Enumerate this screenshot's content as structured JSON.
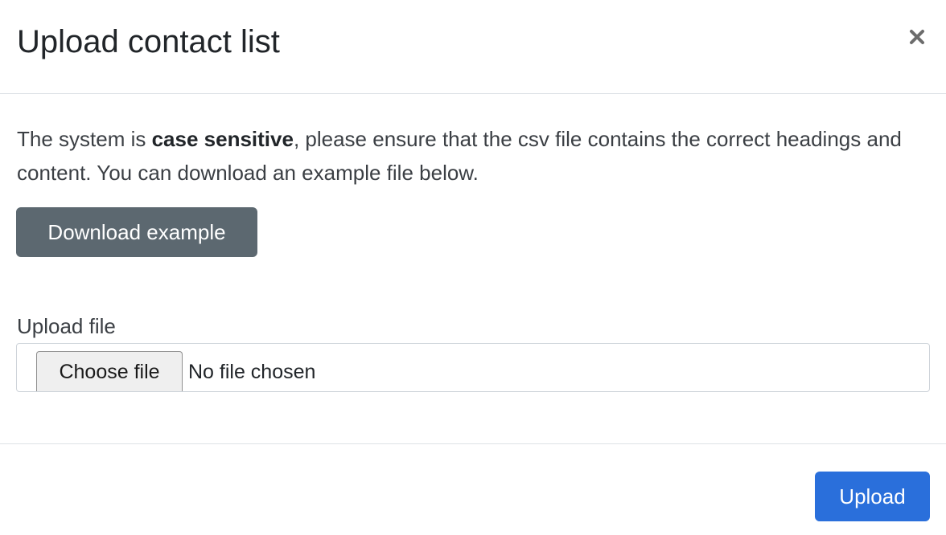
{
  "modal": {
    "title": "Upload contact list",
    "close_icon": "close-icon"
  },
  "body": {
    "intro_before": "The system is ",
    "intro_bold": "case sensitive",
    "intro_after": ", please ensure that the csv file contains the correct headings and content. You can download an example file below.",
    "download_label": "Download example",
    "upload_label": "Upload file",
    "file_input": {
      "button_label": "Choose file",
      "status_text": "No file chosen"
    }
  },
  "footer": {
    "upload_label": "Upload"
  },
  "colors": {
    "secondary_button": "#5c6870",
    "primary_button": "#2a6fdb",
    "divider": "#dee2e6"
  }
}
